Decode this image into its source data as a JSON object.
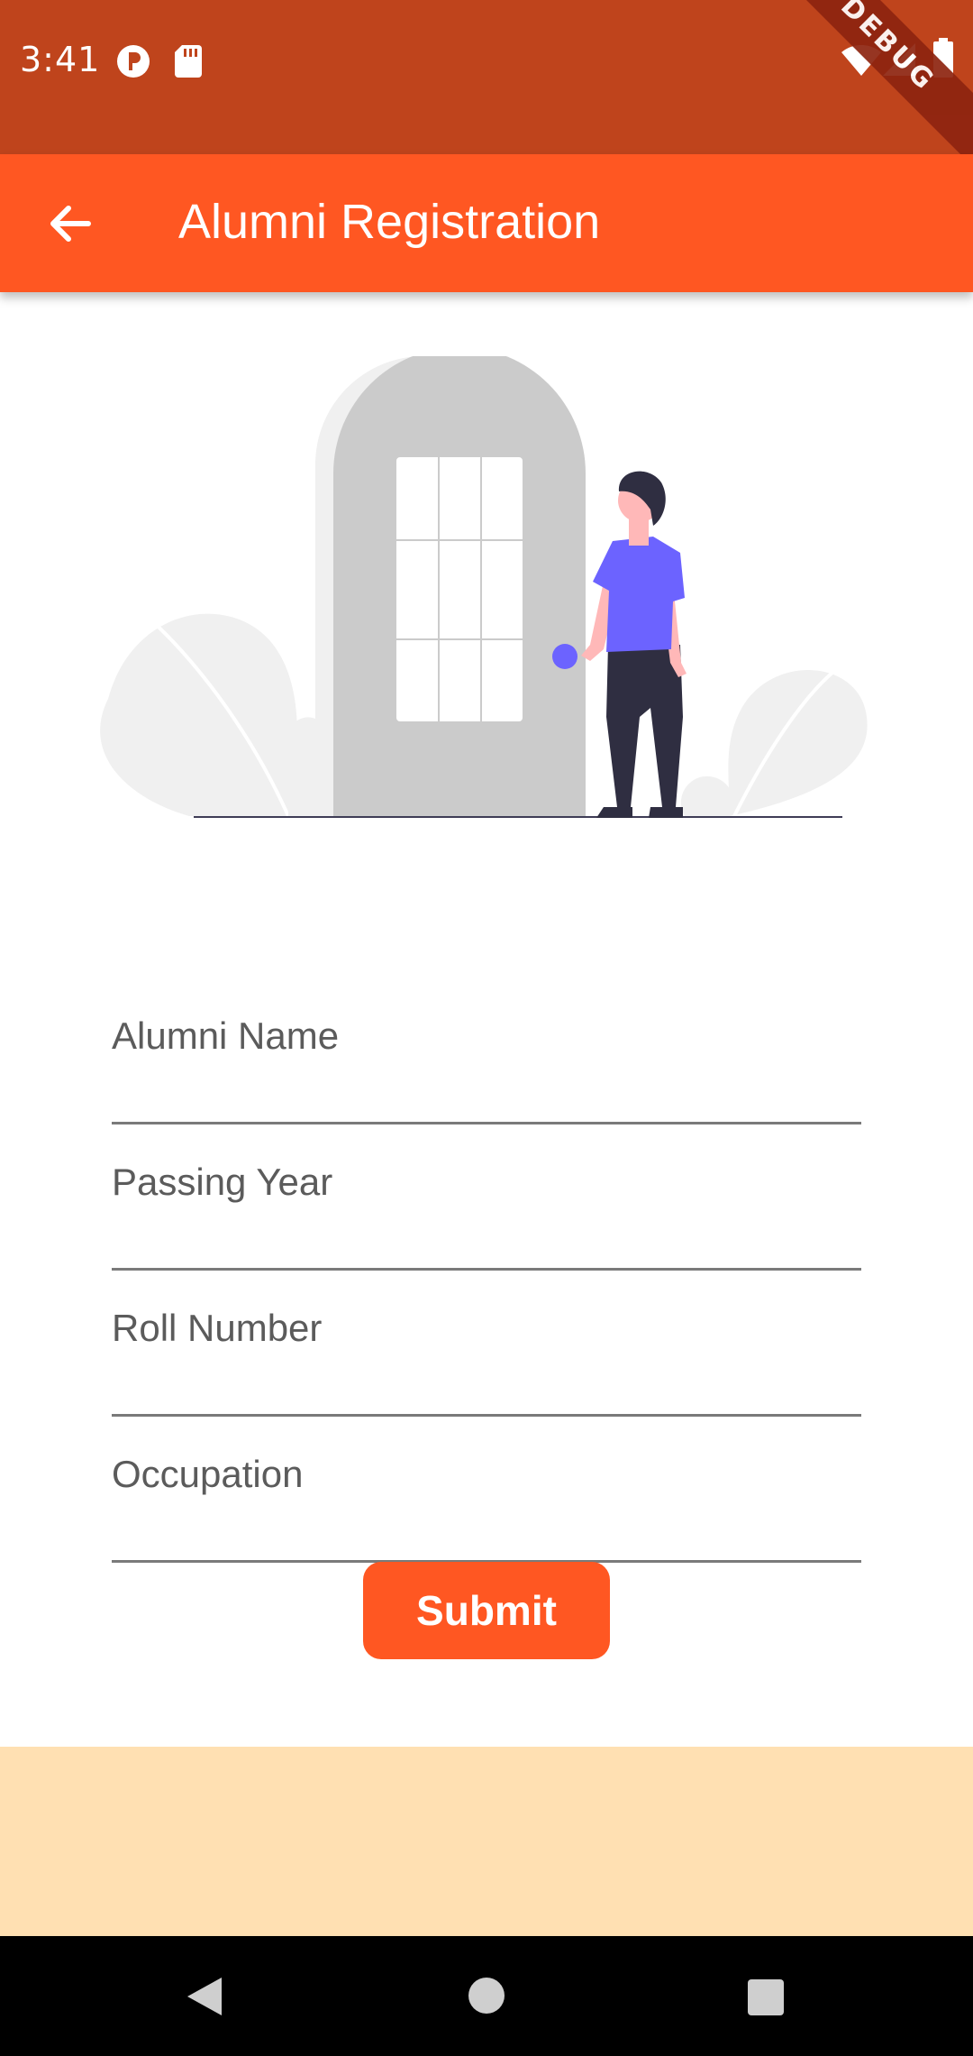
{
  "status_bar": {
    "time": "3:41",
    "left_icons": [
      "notification-p-icon",
      "sd-card-icon"
    ],
    "right_icons": [
      "wifi-icon",
      "signal-icon",
      "battery-icon"
    ],
    "debug_label": "DEBUG"
  },
  "app_bar": {
    "back_icon": "arrow-back-icon",
    "title": "Alumni Registration"
  },
  "form": {
    "fields": [
      {
        "label": "Alumni Name"
      },
      {
        "label": "Passing Year"
      },
      {
        "label": "Roll Number"
      },
      {
        "label": "Occupation"
      }
    ],
    "submit_label": "Submit"
  },
  "nav_bar": {
    "icons": [
      "back-triangle-icon",
      "home-circle-icon",
      "recents-square-icon"
    ]
  },
  "colors": {
    "status_bar": "#BF441C",
    "app_bar": "#FF5722",
    "footer": "#FFE0B2",
    "accent_figure": "#6C63FF"
  }
}
